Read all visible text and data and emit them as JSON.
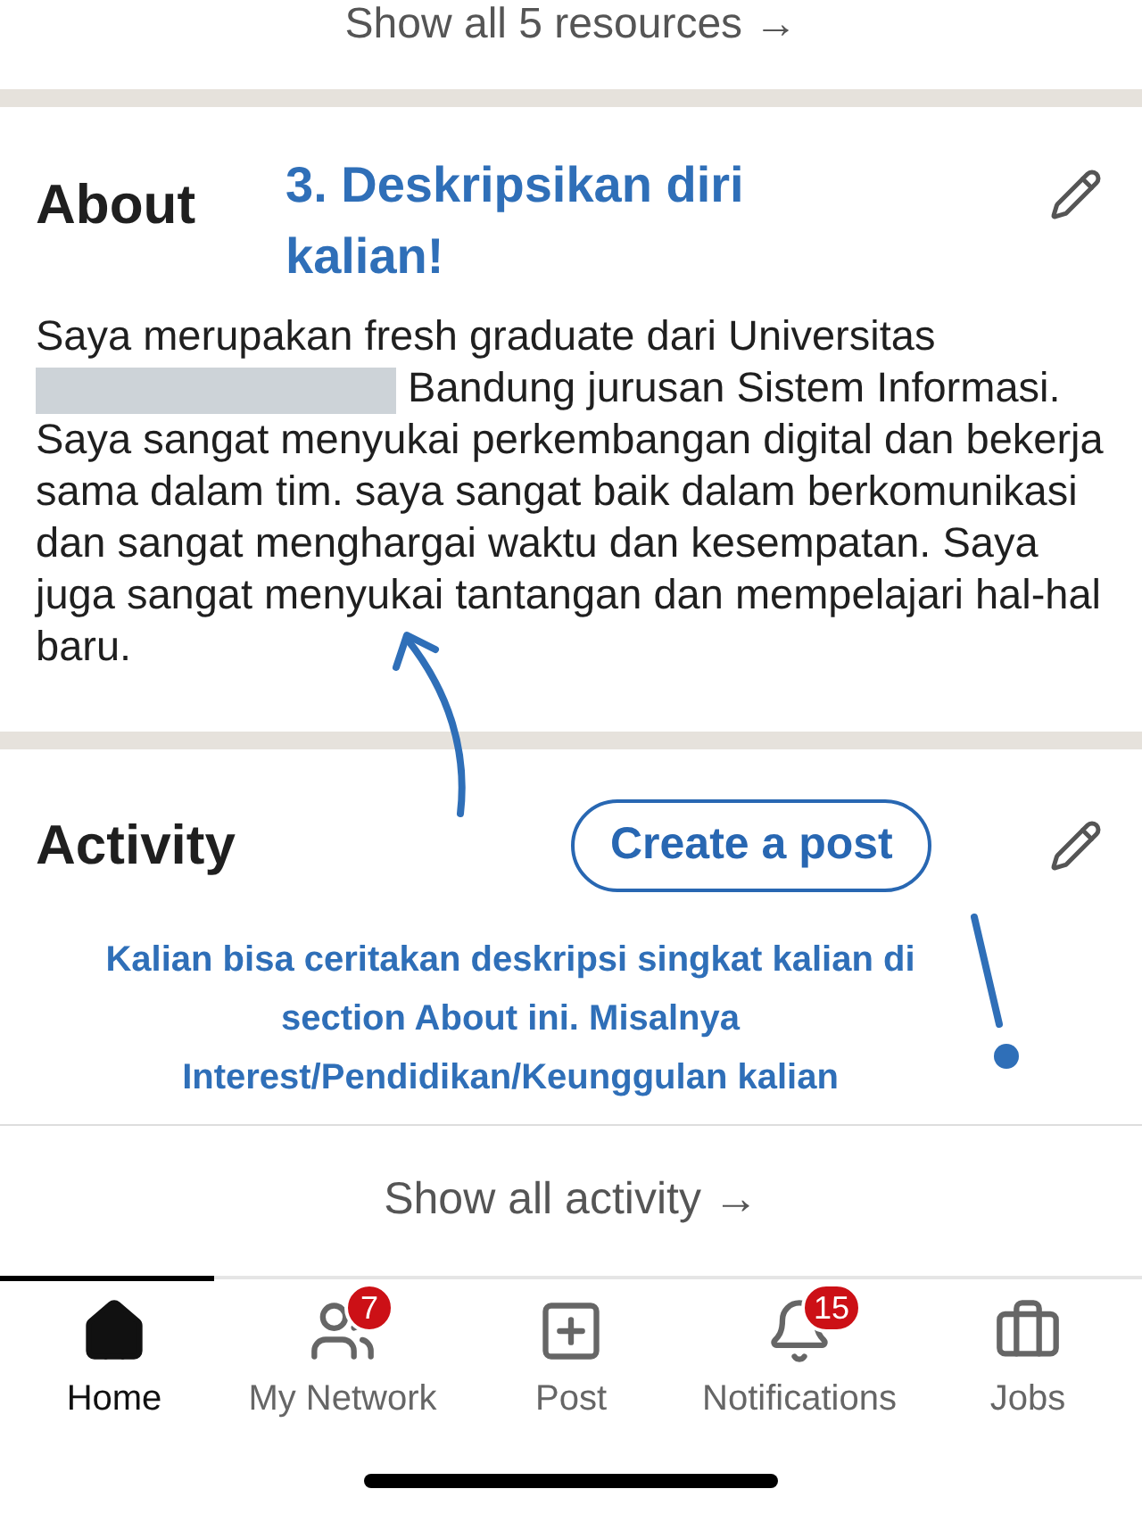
{
  "top_link": {
    "label": "Show all 5 resources →"
  },
  "about": {
    "title": "About",
    "annotation": "3. Deskripsikan diri kalian!",
    "text_before": "Saya merupakan fresh graduate dari Universitas",
    "text_after": "Bandung jurusan Sistem Informasi. Saya sangat menyukai perkembangan digital dan bekerja sama dalam tim. saya sangat baik dalam berkomunikasi dan sangat menghargai waktu dan kesempatan. Saya juga sangat menyukai tantangan dan mempelajari hal-hal baru."
  },
  "activity": {
    "title": "Activity",
    "button": "Create a post",
    "annotation": "Kalian bisa ceritakan deskripsi singkat kalian di section About ini. Misalnya Interest/Pendidikan/Keunggulan kalian",
    "footer_link": "Show all activity →"
  },
  "nav": [
    {
      "label": "Home",
      "kind": "home",
      "selected": true
    },
    {
      "label": "My Network",
      "kind": "network",
      "selected": false,
      "badge": "7"
    },
    {
      "label": "Post",
      "kind": "post",
      "selected": false
    },
    {
      "label": "Notifications",
      "kind": "bell",
      "selected": false,
      "badge": "15"
    },
    {
      "label": "Jobs",
      "kind": "jobs",
      "selected": false
    }
  ]
}
